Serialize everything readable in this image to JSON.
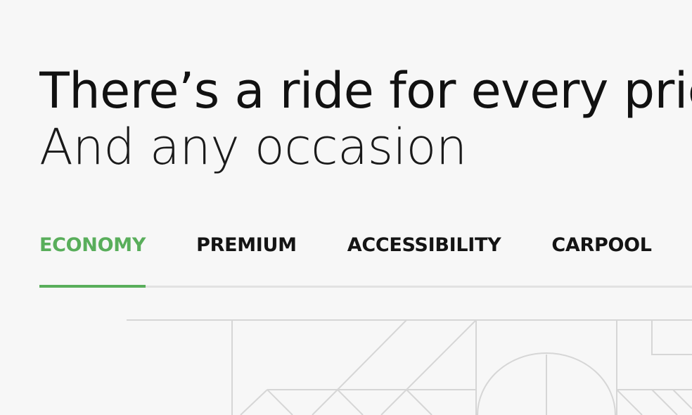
{
  "hero": {
    "headline": "There’s a ride for every price",
    "subheadline": "And any occasion"
  },
  "tabs": [
    {
      "label": "ECONOMY",
      "active": true
    },
    {
      "label": "PREMIUM",
      "active": false
    },
    {
      "label": "ACCESSIBILITY",
      "active": false
    },
    {
      "label": "CARPOOL",
      "active": false
    }
  ],
  "colors": {
    "accent": "#59ae5b",
    "text": "#111111",
    "background": "#f7f7f7",
    "divider": "#e2e2e2",
    "line_art": "#d6d6d6"
  }
}
